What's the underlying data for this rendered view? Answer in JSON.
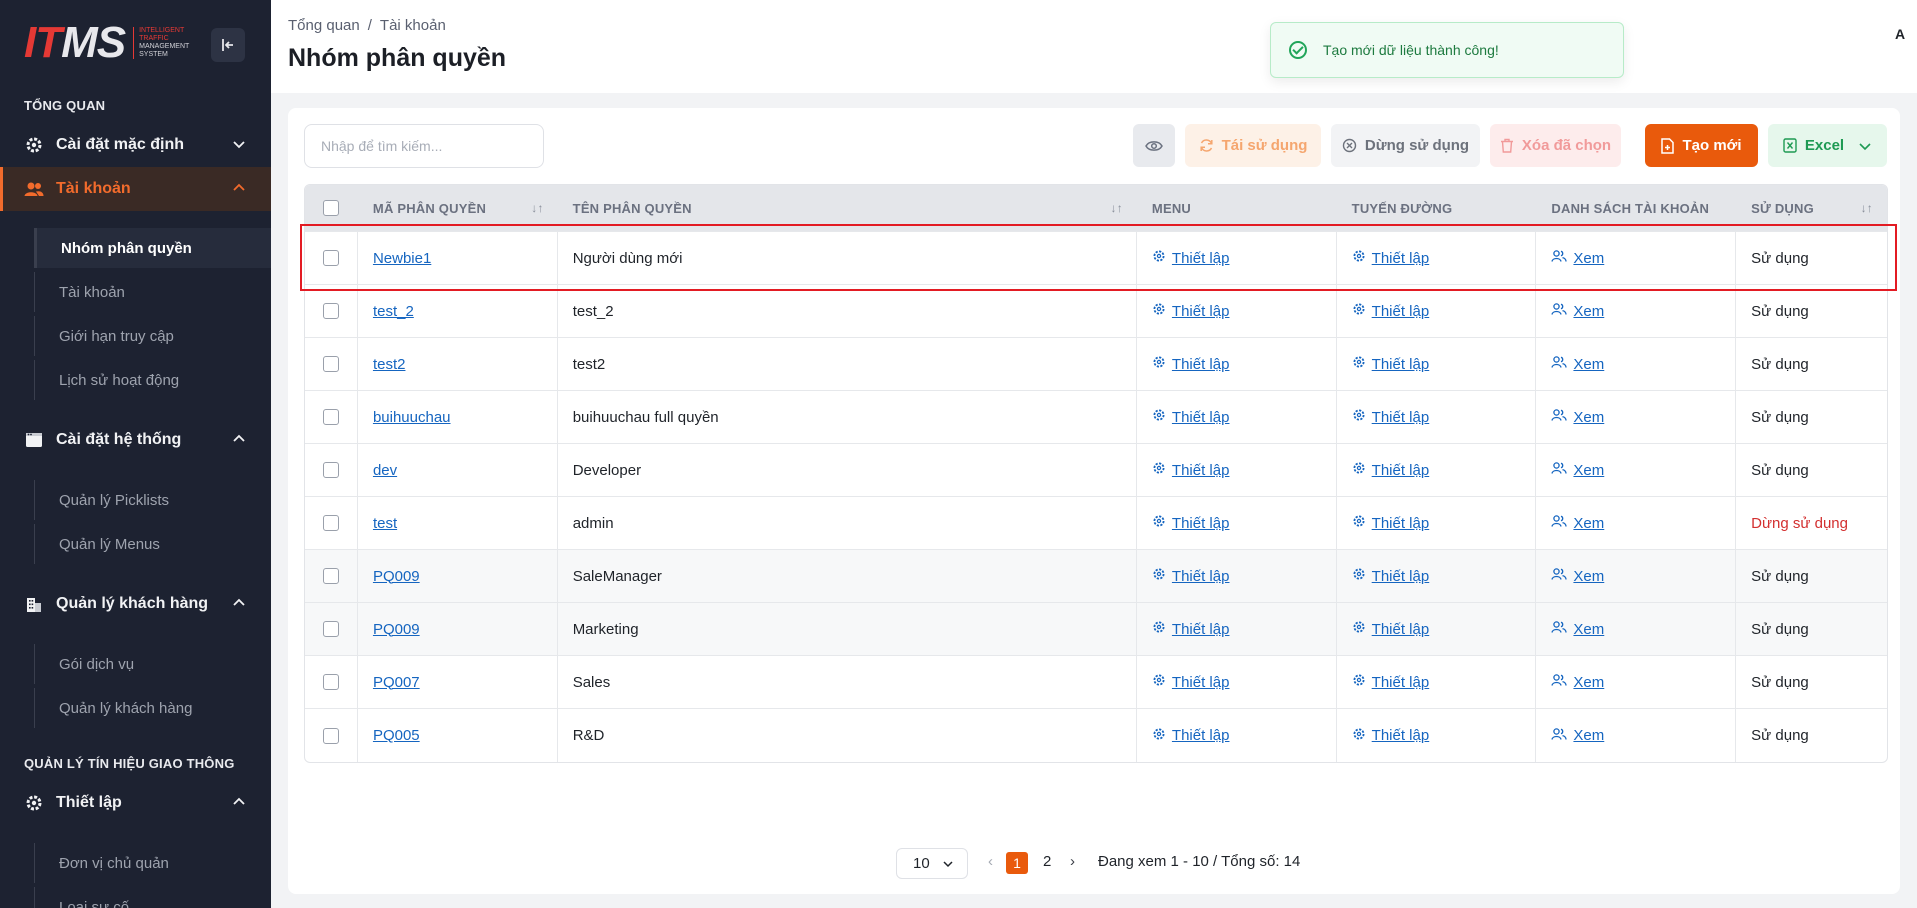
{
  "logo": {
    "mark_a": "IT",
    "mark_b": "MS",
    "sub_1": "INTELLIGENT",
    "sub_2": "TRAFFIC",
    "sub_3": "MANAGEMENT",
    "sub_4": "SYSTEM"
  },
  "sidebar": {
    "section_overview": "TỔNG QUAN",
    "group_default": "Cài đặt mặc định",
    "group_account": "Tài khoản",
    "account_items": [
      "Nhóm phân quyền",
      "Tài khoản",
      "Giới hạn truy cập",
      "Lịch sử hoạt động"
    ],
    "group_system": "Cài đặt hệ thống",
    "system_items": [
      "Quản lý Picklists",
      "Quản lý Menus"
    ],
    "group_customer": "Quản lý khách hàng",
    "customer_items": [
      "Gói dịch vụ",
      "Quản lý khách hàng"
    ],
    "section_signal": "QUẢN LÝ TÍN HIỆU GIAO THÔNG",
    "group_setup": "Thiết lập",
    "setup_items": [
      "Đơn vị chủ quản",
      "Loại sự cố"
    ]
  },
  "header": {
    "breadcrumb": [
      "Tổng quan",
      "Tài khoản"
    ],
    "breadcrumb_sep": "/",
    "title": "Nhóm phân quyền",
    "user_initial": "A"
  },
  "toast": {
    "message": "Tạo mới dữ liệu thành công!"
  },
  "toolbar": {
    "search_placeholder": "Nhập để tìm kiếm...",
    "reuse": "Tái sử dụng",
    "stop": "Dừng sử dụng",
    "delete": "Xóa đã chọn",
    "create": "Tạo mới",
    "excel": "Excel"
  },
  "table": {
    "headers": [
      "MÃ PHÂN QUYỀN",
      "TÊN PHÂN QUYỀN",
      "MENU",
      "TUYẾN ĐƯỜNG",
      "DANH SÁCH TÀI KHOẢN",
      "SỬ DỤNG"
    ],
    "rows": [
      {
        "code": "Newbie1",
        "name": "Người dùng mới",
        "menu": "Thiết lập",
        "route": "Thiết lập",
        "accounts": "Xem",
        "status": "Sử dụng",
        "stopped": false
      },
      {
        "code": "test_2",
        "name": "test_2",
        "menu": "Thiết lập",
        "route": "Thiết lập",
        "accounts": "Xem",
        "status": "Sử dụng",
        "stopped": false
      },
      {
        "code": "test2",
        "name": "test2",
        "menu": "Thiết lập",
        "route": "Thiết lập",
        "accounts": "Xem",
        "status": "Sử dụng",
        "stopped": false
      },
      {
        "code": "buihuuchau",
        "name": "buihuuchau full quyền",
        "menu": "Thiết lập",
        "route": "Thiết lập",
        "accounts": "Xem",
        "status": "Sử dụng",
        "stopped": false
      },
      {
        "code": "dev",
        "name": "Developer",
        "menu": "Thiết lập",
        "route": "Thiết lập",
        "accounts": "Xem",
        "status": "Sử dụng",
        "stopped": false
      },
      {
        "code": "test",
        "name": "admin",
        "menu": "Thiết lập",
        "route": "Thiết lập",
        "accounts": "Xem",
        "status": "Dừng sử dụng",
        "stopped": true
      },
      {
        "code": "PQ009",
        "name": "SaleManager",
        "menu": "Thiết lập",
        "route": "Thiết lập",
        "accounts": "Xem",
        "status": "Sử dụng",
        "stopped": false
      },
      {
        "code": "PQ009",
        "name": "Marketing",
        "menu": "Thiết lập",
        "route": "Thiết lập",
        "accounts": "Xem",
        "status": "Sử dụng",
        "stopped": false
      },
      {
        "code": "PQ007",
        "name": "Sales",
        "menu": "Thiết lập",
        "route": "Thiết lập",
        "accounts": "Xem",
        "status": "Sử dụng",
        "stopped": false
      },
      {
        "code": "PQ005",
        "name": "R&D",
        "menu": "Thiết lập",
        "route": "Thiết lập",
        "accounts": "Xem",
        "status": "Sử dụng",
        "stopped": false
      }
    ]
  },
  "pagination": {
    "page_size": "10",
    "page_1": "1",
    "page_2": "2",
    "info": "Đang xem 1 - 10 / Tổng số: 14"
  },
  "colors": {
    "accent": "#e95a0c",
    "sidebar_bg": "#1d2231",
    "link": "#1565c0",
    "danger": "#d32f2f",
    "success": "#22a55a"
  }
}
